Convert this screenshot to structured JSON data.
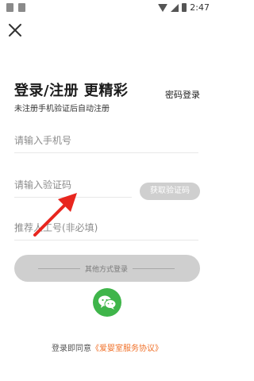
{
  "status_bar": {
    "time": "2:47",
    "icons": [
      "notification-icon",
      "image-icon",
      "wifi-icon",
      "signal-icon",
      "battery-icon"
    ]
  },
  "header": {
    "title": "登录/注册 更精彩",
    "subtitle": "未注册手机验证后自动注册",
    "password_login": "密码登录"
  },
  "form": {
    "phone_placeholder": "请输入手机号",
    "code_placeholder": "请输入验证码",
    "get_code_label": "获取验证码",
    "referrer_placeholder": "推荐人工号(非必填)"
  },
  "login": {
    "other_methods_label": "其他方式登录"
  },
  "agreement": {
    "prefix": "登录即同意",
    "link_text": "《爱婴室服务协议》"
  },
  "colors": {
    "accent_orange": "#f07028",
    "wechat_green": "#3fb54a",
    "disabled_gray": "#cfcfcf",
    "annotation_red": "#e8261f"
  }
}
